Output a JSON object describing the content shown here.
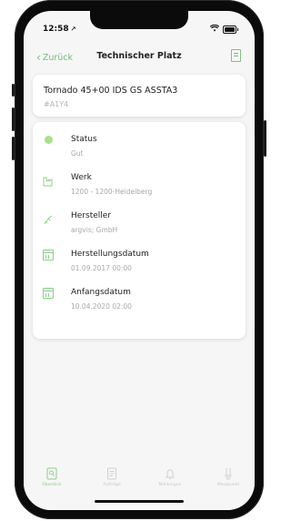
{
  "status_bar": {
    "time": "12:58",
    "time_arrow": "↗"
  },
  "nav": {
    "back_label": "Zurück",
    "title": "Technischer Platz"
  },
  "header_card": {
    "name": "Tornado 45+00 IDS GS ASSTA3",
    "code": "#A1Y4"
  },
  "details": [
    {
      "label": "Status",
      "value": "Gut",
      "icon": "status-dot-icon"
    },
    {
      "label": "Werk",
      "value": "1200 - 1200-Heidelberg",
      "icon": "factory-icon"
    },
    {
      "label": "Hersteller",
      "value": "argvis; GmbH",
      "icon": "manufacturer-icon"
    },
    {
      "label": "Herstellungsdatum",
      "value": "01.09.2017 00:00",
      "icon": "calendar-icon"
    },
    {
      "label": "Anfangsdatum",
      "value": "10.04.2020 02:00",
      "icon": "calendar-icon"
    }
  ],
  "tabs": [
    {
      "label": "Überblick",
      "icon": "overview-icon",
      "active": true
    },
    {
      "label": "Aufträge",
      "icon": "orders-icon",
      "active": false
    },
    {
      "label": "Meldungen",
      "icon": "bell-icon",
      "active": false
    },
    {
      "label": "Messpunkt",
      "icon": "measure-point-icon",
      "active": false
    }
  ],
  "colors": {
    "accent": "#6fbf7a",
    "status_ok": "#a8e08c",
    "muted_text": "#a9a9a9"
  }
}
